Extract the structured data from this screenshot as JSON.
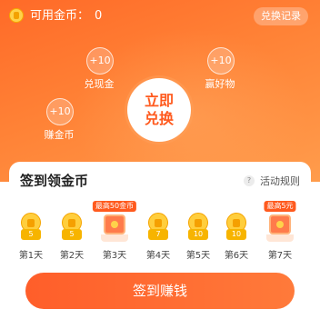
{
  "header": {
    "balance_label": "可用金币：",
    "balance_value": "0",
    "record_button": "兑换记录"
  },
  "bubbles": [
    {
      "amount": "+10",
      "label": "兑现金"
    },
    {
      "amount": "+10",
      "label": "赢好物"
    },
    {
      "amount": "+10",
      "label": "赚金币"
    }
  ],
  "redeem": {
    "line1": "立即",
    "line2": "兑换"
  },
  "signin": {
    "title": "签到领金币",
    "rules_label": "活动规则",
    "rules_icon": "?",
    "days": [
      {
        "label": "第1天",
        "amount": "5",
        "type": "coin"
      },
      {
        "label": "第2天",
        "amount": "5",
        "type": "coin"
      },
      {
        "label": "第3天",
        "badge": "最高50金币",
        "type": "box"
      },
      {
        "label": "第4天",
        "amount": "7",
        "type": "coin"
      },
      {
        "label": "第5天",
        "amount": "10",
        "type": "coin"
      },
      {
        "label": "第6天",
        "amount": "10",
        "type": "coin"
      },
      {
        "label": "第7天",
        "badge": "最高5元",
        "type": "box"
      }
    ],
    "button_label": "签到赚钱"
  },
  "colors": {
    "accent": "#ff6a28",
    "coin": "#ffce3d",
    "badge": "#ff5a1e"
  }
}
